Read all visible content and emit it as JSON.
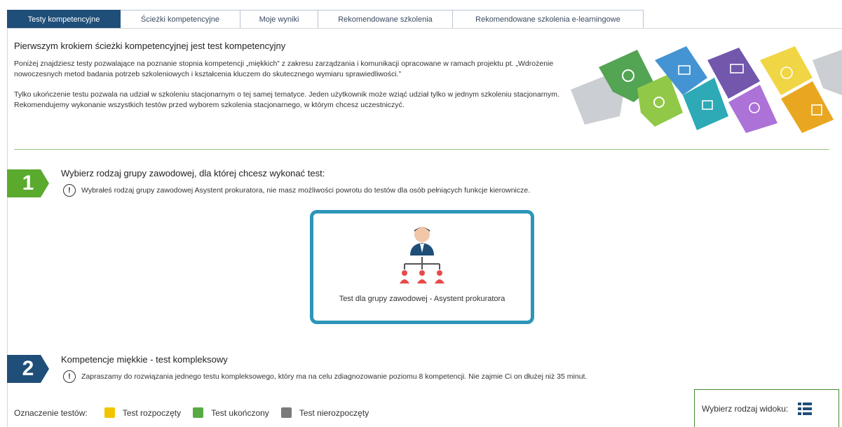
{
  "tabs": [
    {
      "label": "Testy kompetencyjne",
      "active": true
    },
    {
      "label": "Ścieżki kompetencyjne",
      "active": false
    },
    {
      "label": "Moje wyniki",
      "active": false
    },
    {
      "label": "Rekomendowane szkolenia",
      "active": false
    },
    {
      "label": "Rekomendowane szkolenia e-learningowe",
      "active": false
    }
  ],
  "intro": {
    "title": "Pierwszym krokiem ścieżki kompetencyjnej jest test kompetencyjny",
    "p1": "Poniżej znajdziesz testy pozwalające na poznanie stopnia kompetencji „miękkich” z zakresu zarządzania i komunikacji opracowane w ramach projektu pt. „Wdrożenie nowoczesnych metod badania potrzeb szkoleniowych i kształcenia kluczem do skutecznego wymiaru sprawiedliwości.”",
    "p2": "Tylko ukończenie testu pozwala na udział w szkoleniu stacjonarnym o tej samej tematyce. Jeden użytkownik może wziąć udział tylko w jednym szkoleniu stacjonarnym. Rekomendujemy wykonanie wszystkich testów przed wyborem szkolenia stacjonarnego, w którym chcesz uczestniczyć."
  },
  "step1": {
    "number": "1",
    "title": "Wybierz rodzaj grupy zawodowej, dla której chcesz wykonać test:",
    "info": "Wybrałeś rodzaj grupy zawodowej Asystent prokuratora, nie masz możliwości powrotu do testów dla osób pełniących funkcje kierownicze.",
    "card_label": "Test dla grupy zawodowej - Asystent prokuratora"
  },
  "step2": {
    "number": "2",
    "title": "Kompetencje miękkie - test kompleksowy",
    "info": "Zapraszamy do rozwiązania jednego testu kompleksowego, który ma na celu zdiagnozowanie poziomu 8 kompetencji. Nie zajmie Ci on dłużej niż 35 minut."
  },
  "legend": {
    "label": "Oznaczenie testów:",
    "items": [
      {
        "label": "Test rozpoczęty",
        "color": "#f2c500"
      },
      {
        "label": "Test ukończony",
        "color": "#5aaa44"
      },
      {
        "label": "Test nierozpoczęty",
        "color": "#7a7a7a"
      }
    ]
  },
  "view": {
    "label": "Wybierz rodzaj widoku:",
    "icon": "list-view-icon"
  },
  "colors": {
    "tab_active": "#1f4e79",
    "step1": "#5aaa2e",
    "step2": "#1f4e79",
    "card_border": "#2c95b9"
  }
}
